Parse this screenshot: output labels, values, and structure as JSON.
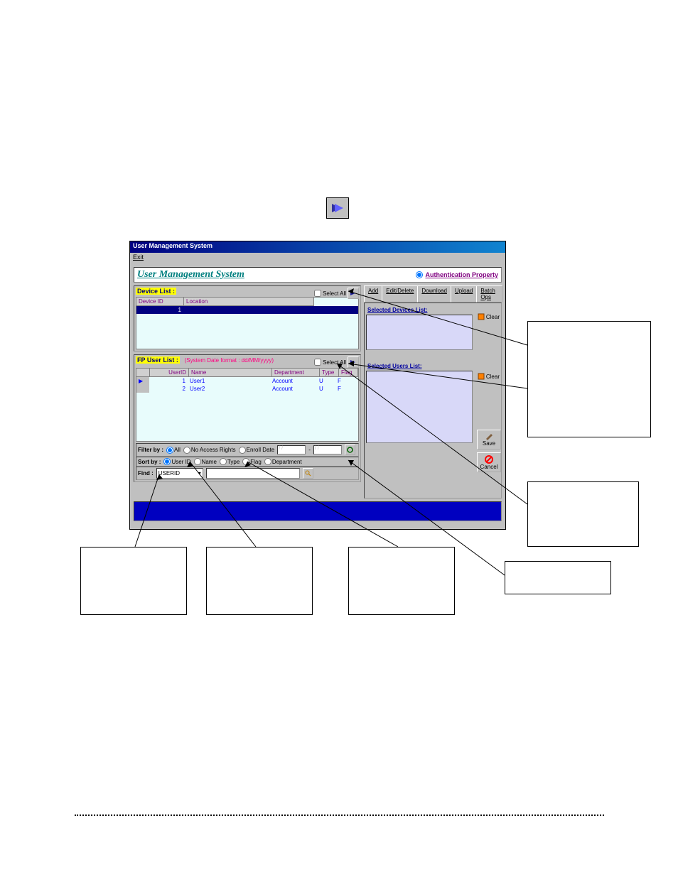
{
  "window_title": "User Management System",
  "menu": {
    "exit": "Exit"
  },
  "header": {
    "title": "User Management System",
    "auth_prop": "Authentication Property"
  },
  "device_list": {
    "label": "Device List :",
    "select_all": "Select All",
    "cols": {
      "id": "Device ID",
      "loc": "Location"
    },
    "rows": [
      {
        "id": "1",
        "loc": ""
      }
    ]
  },
  "user_list": {
    "label": "FP User List :",
    "hint": "(System Date format : dd/MM/yyyy)",
    "select_all": "Select All",
    "cols": {
      "id": "UserID",
      "name": "Name",
      "dept": "Department",
      "type": "Type",
      "flag": "Flag"
    },
    "rows": [
      {
        "id": "1",
        "name": "User1",
        "dept": "Account",
        "type": "U",
        "flag": "F"
      },
      {
        "id": "2",
        "name": "User2",
        "dept": "Account",
        "type": "U",
        "flag": "F"
      }
    ]
  },
  "tabs": {
    "add": "Add",
    "edit": "Edit/Delete",
    "download": "Download",
    "upload": "Upload",
    "batch": "Batch Ops"
  },
  "selected": {
    "devices_label": "Selected Devices List:",
    "users_label": "Selected Users List:",
    "clear": "Clear"
  },
  "actions": {
    "save": "Save",
    "cancel": "Cancel"
  },
  "filter": {
    "label": "Filter by :",
    "all": "All",
    "no_access": "No Access Rights",
    "enroll_date": "Enroll Date",
    "placeholder": "/ /"
  },
  "sort": {
    "label": "Sort by :",
    "userid": "User ID",
    "name": "Name",
    "type": "Type",
    "flag": "Flag",
    "dept": "Department"
  },
  "find": {
    "label": "Find :",
    "selected": "USERID"
  }
}
